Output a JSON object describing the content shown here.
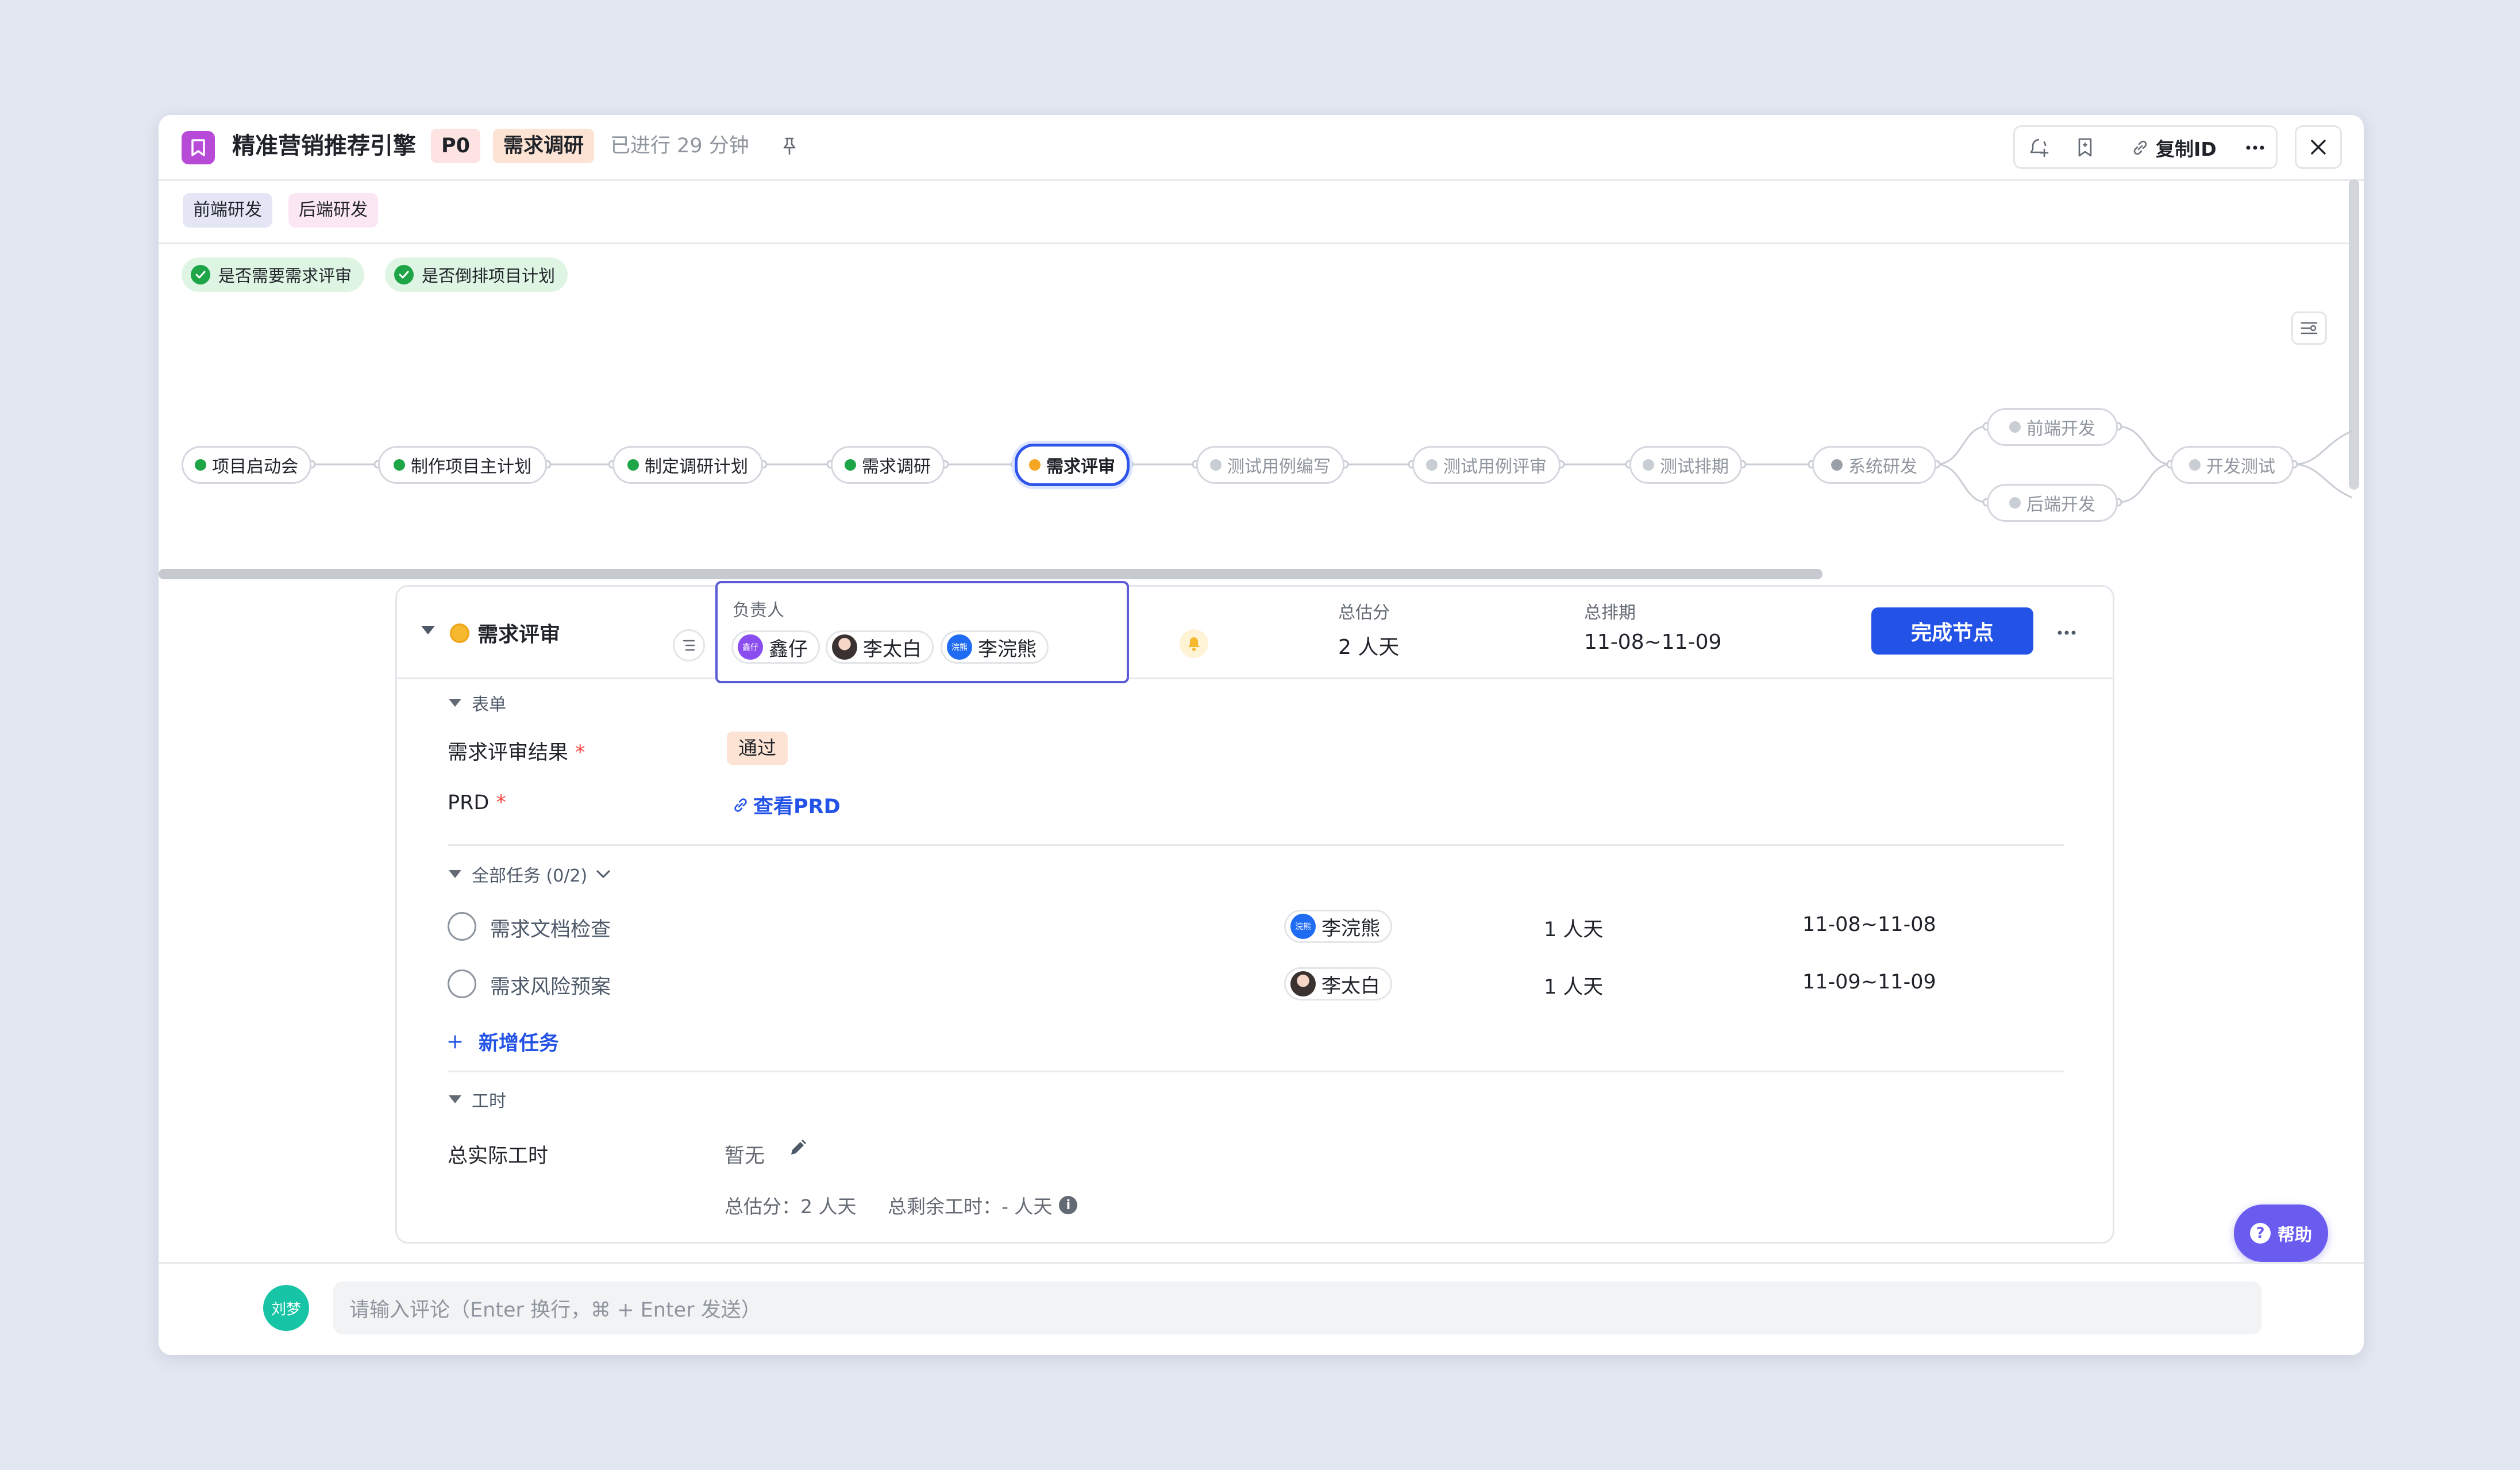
{
  "header": {
    "title": "精准营销推荐引擎",
    "priority": "P0",
    "stage": "需求调研",
    "elapsed": "已进行 29 分钟",
    "copy_id_label": "复制ID",
    "icons": [
      "pin-icon",
      "follow-icon",
      "bookmark-icon",
      "link-icon",
      "more-icon",
      "close-icon"
    ]
  },
  "roles": [
    "前端研发",
    "后端研发"
  ],
  "conditions": [
    "是否需要需求评审",
    "是否倒排项目计划"
  ],
  "flow": {
    "nodes": [
      {
        "label": "项目启动会",
        "status": "done"
      },
      {
        "label": "制作项目主计划",
        "status": "done"
      },
      {
        "label": "制定调研计划",
        "status": "done"
      },
      {
        "label": "需求调研",
        "status": "done"
      },
      {
        "label": "需求评审",
        "status": "current"
      },
      {
        "label": "测试用例编写",
        "status": "pending"
      },
      {
        "label": "测试用例评审",
        "status": "pending"
      },
      {
        "label": "测试排期",
        "status": "pending"
      },
      {
        "label": "系统研发",
        "status": "pending"
      },
      {
        "label": "前端开发",
        "status": "pending"
      },
      {
        "label": "后端开发",
        "status": "pending"
      },
      {
        "label": "开发测试",
        "status": "pending"
      }
    ],
    "colors": {
      "done": "#1ea548",
      "current": "#f5a623",
      "pending": "#c9cdd4"
    }
  },
  "node_detail": {
    "name": "需求评审",
    "owner_label": "负责人",
    "owners": [
      {
        "name": "鑫仔",
        "avatar_text": "鑫仔",
        "avatar": "purple"
      },
      {
        "name": "李太白",
        "avatar_text": "",
        "avatar": "photo"
      },
      {
        "name": "李浣熊",
        "avatar_text": "浣熊",
        "avatar": "blue"
      }
    ],
    "estimate_label": "总估分",
    "estimate": "2 人天",
    "schedule_label": "总排期",
    "schedule": "11-08~11-09",
    "complete_button": "完成节点"
  },
  "form": {
    "section": "表单",
    "fields": [
      {
        "label": "需求评审结果",
        "value": "通过"
      },
      {
        "label": "PRD",
        "value": "查看PRD"
      }
    ]
  },
  "tasks": {
    "section": "全部任务 (0/2)",
    "items": [
      {
        "name": "需求文档检查",
        "owner": "李浣熊",
        "owner_avatar": "blue",
        "owner_avatar_text": "浣熊",
        "effort": "1 人天",
        "date": "11-08~11-08"
      },
      {
        "name": "需求风险预案",
        "owner": "李太白",
        "owner_avatar": "photo",
        "owner_avatar_text": "",
        "effort": "1 人天",
        "date": "11-09~11-09"
      }
    ],
    "add_label": "新增任务"
  },
  "worktime": {
    "section": "工时",
    "label": "总实际工时",
    "value": "暂无",
    "summary_estimate": "总估分：2 人天",
    "summary_remaining": "总剩余工时：- 人天"
  },
  "comment": {
    "user": "刘梦",
    "placeholder": "请输入评论（Enter 换行，⌘ + Enter 发送）"
  },
  "help_label": "帮助"
}
